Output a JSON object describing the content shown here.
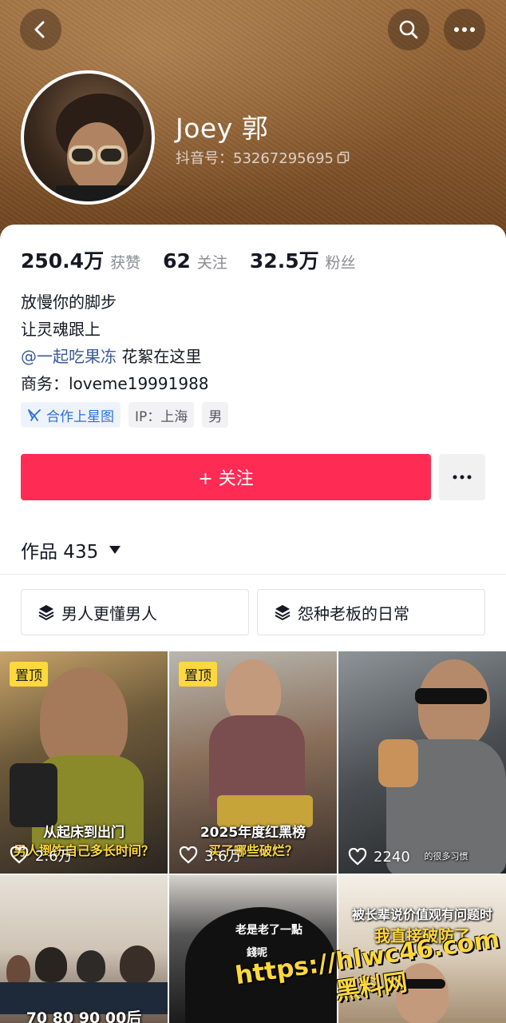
{
  "header": {
    "back_icon": "chevron-left-icon",
    "search_icon": "search-icon",
    "more_icon": "more-dots-icon"
  },
  "profile": {
    "name": "Joey 郭",
    "douyin_id": "抖音号：53267295695",
    "copy_icon": "copy-icon"
  },
  "stats": [
    {
      "value": "250.4万",
      "label": "获赞"
    },
    {
      "value": "62",
      "label": "关注"
    },
    {
      "value": "32.5万",
      "label": "粉丝"
    }
  ],
  "bio": {
    "line1": "放慢你的脚步",
    "line2": "让灵魂跟上",
    "mention": "@一起吃果冻",
    "line3_rest": " 花絮在这里",
    "business": "商务：loveme19991988"
  },
  "tags": {
    "star": "合作上星图",
    "ip": "IP：上海",
    "gender": "男"
  },
  "actions": {
    "follow": "+ 关注",
    "more": "···"
  },
  "works": {
    "label": "作品 435"
  },
  "collections": [
    {
      "label": "男人更懂男人",
      "icon": "layers-icon"
    },
    {
      "label": "怨种老板的日常",
      "icon": "layers-icon"
    }
  ],
  "videos": [
    {
      "pinned": "置顶",
      "caption1": "从起床到出门",
      "caption2": "男人捯饬自己多长时间？",
      "likes": "2.6万"
    },
    {
      "pinned": "置顶",
      "caption1": "2025年度红黑榜",
      "caption2": "买了哪些破烂？",
      "likes": "3.6万"
    },
    {
      "caption1": "的很多习惯",
      "likes": "2240"
    },
    {
      "caption1": "70 80 90 00后"
    },
    {
      "caption1": "老是老了一點",
      "caption2": "錢呢"
    },
    {
      "caption1": "被长辈说价值观有问题时",
      "caption2": "我直接破防了"
    }
  ],
  "watermark": {
    "url": "https://hlwc46.com",
    "name": "黑料网"
  },
  "colors": {
    "follow_red": "#fe2c55",
    "mention_blue": "#3a5a9a",
    "pin_yellow": "#ffd83d"
  }
}
